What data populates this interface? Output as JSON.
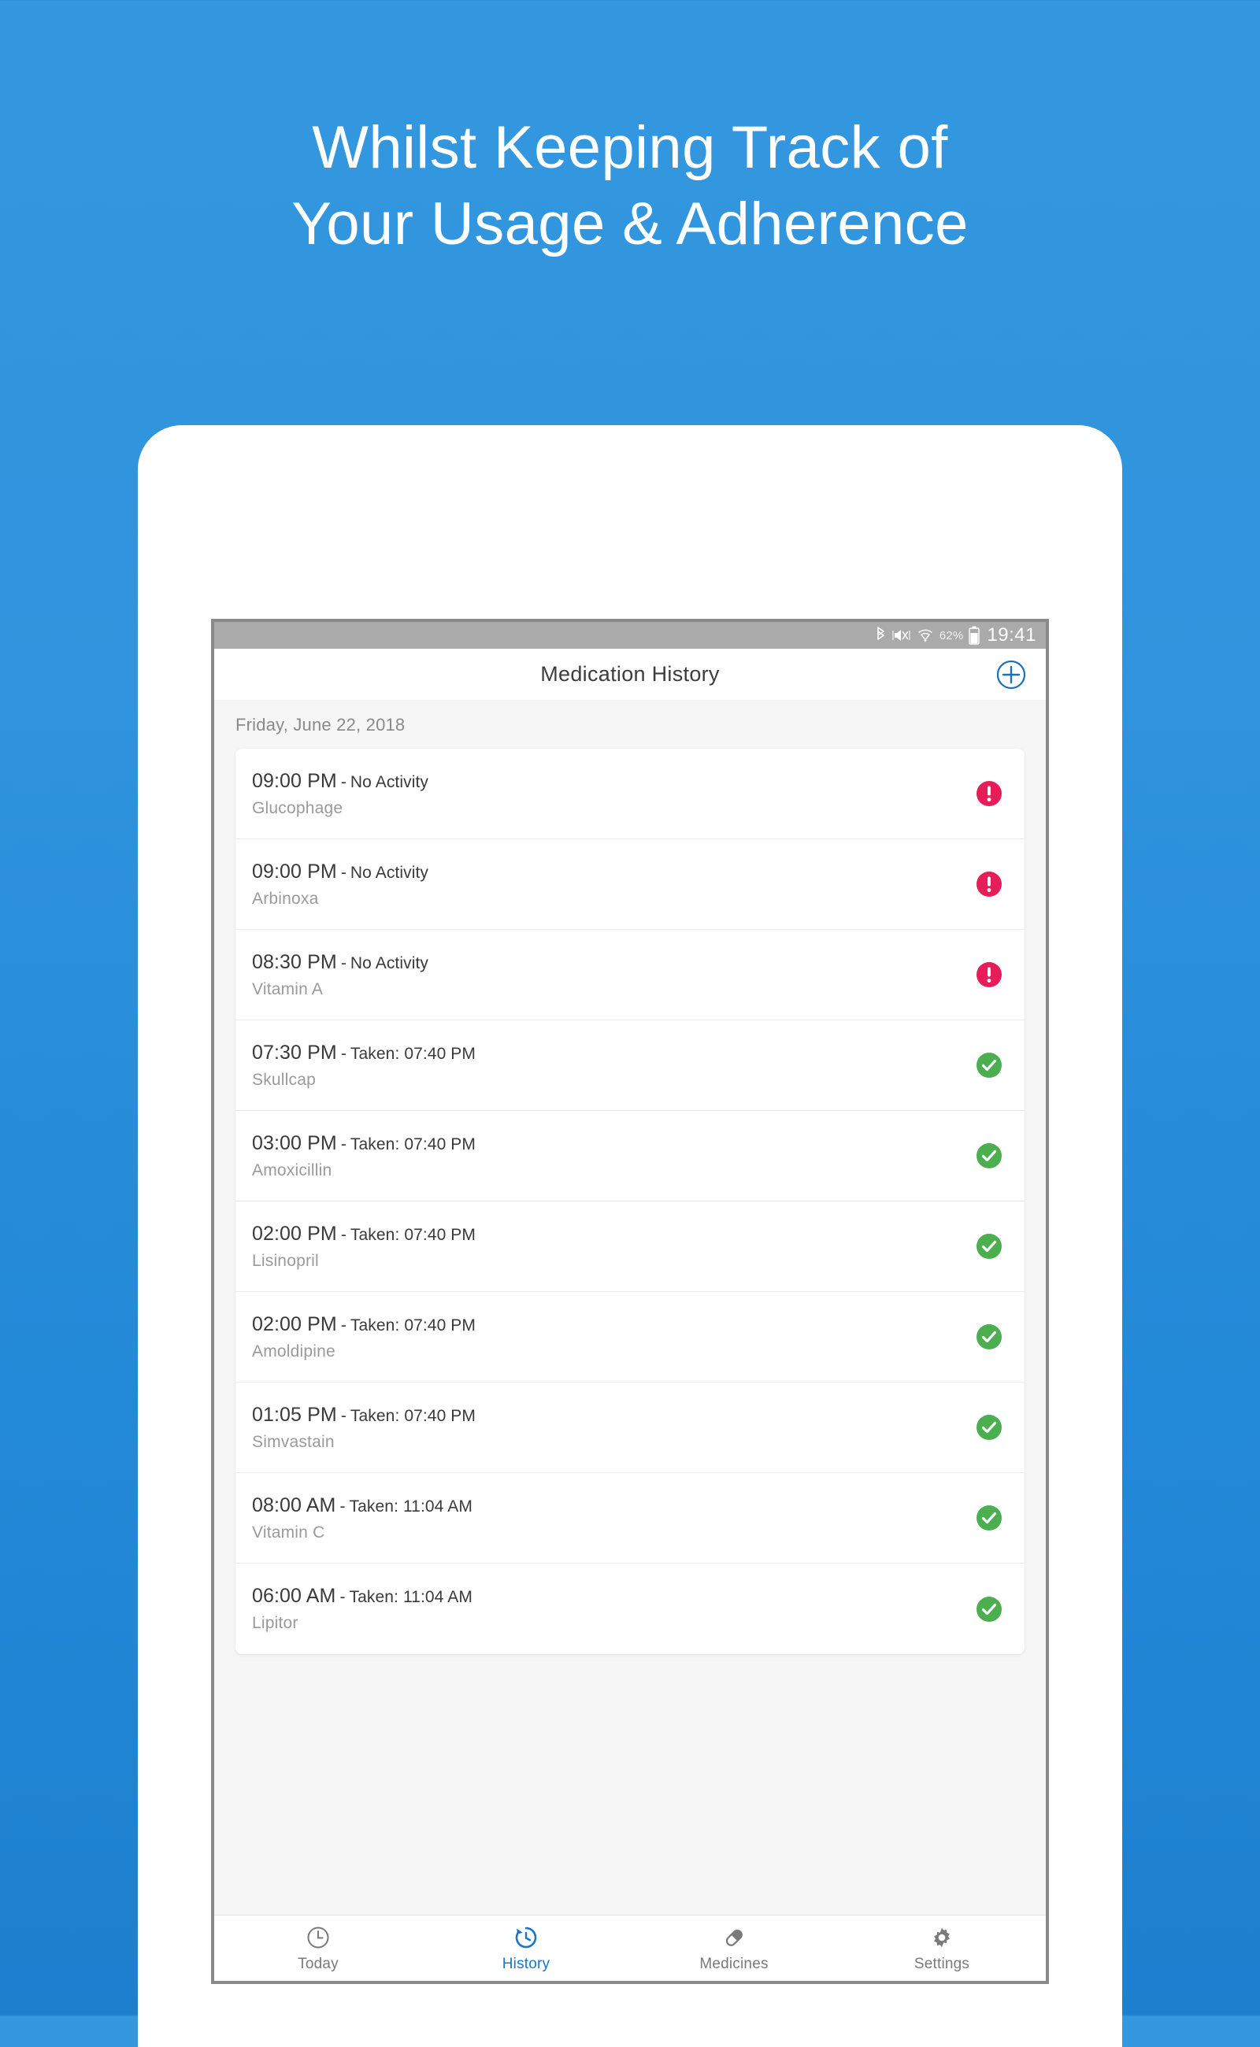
{
  "promo": {
    "headline_line1": "Whilst Keeping Track of",
    "headline_line2": "Your Usage & Adherence",
    "background_top": "#3498e0",
    "background_bottom": "#1d80cf"
  },
  "statusbar": {
    "bluetooth_icon": "bluetooth-icon",
    "mute_icon": "volume-mute-icon",
    "wifi_icon": "wifi-icon",
    "battery_percent": "62%",
    "battery_icon": "battery-icon",
    "clock": "19:41"
  },
  "appbar": {
    "title": "Medication History",
    "add_icon": "plus-circle-icon",
    "accent": "#1976c8"
  },
  "content": {
    "date_header": "Friday, June 22, 2018",
    "rows": [
      {
        "time": "09:00 PM",
        "separator": "-",
        "status": "No Activity",
        "medicine": "Glucophage",
        "badge": "alert",
        "badge_color": "#e71d59"
      },
      {
        "time": "09:00 PM",
        "separator": "-",
        "status": "No Activity",
        "medicine": "Arbinoxa",
        "badge": "alert",
        "badge_color": "#e71d59"
      },
      {
        "time": "08:30 PM",
        "separator": "-",
        "status": "No Activity",
        "medicine": "Vitamin A",
        "badge": "alert",
        "badge_color": "#e71d59"
      },
      {
        "time": "07:30 PM",
        "separator": "-",
        "status": "Taken: 07:40 PM",
        "medicine": "Skullcap",
        "badge": "check",
        "badge_color": "#4caf4f"
      },
      {
        "time": "03:00 PM",
        "separator": "-",
        "status": "Taken: 07:40 PM",
        "medicine": "Amoxicillin",
        "badge": "check",
        "badge_color": "#4caf4f"
      },
      {
        "time": "02:00 PM",
        "separator": "-",
        "status": "Taken: 07:40 PM",
        "medicine": "Lisinopril",
        "badge": "check",
        "badge_color": "#4caf4f"
      },
      {
        "time": "02:00 PM",
        "separator": "-",
        "status": "Taken: 07:40 PM",
        "medicine": "Amoldipine",
        "badge": "check",
        "badge_color": "#4caf4f"
      },
      {
        "time": "01:05 PM",
        "separator": "-",
        "status": "Taken: 07:40 PM",
        "medicine": "Simvastain",
        "badge": "check",
        "badge_color": "#4caf4f"
      },
      {
        "time": "08:00 AM",
        "separator": "-",
        "status": "Taken: 11:04 AM",
        "medicine": "Vitamin C",
        "badge": "check",
        "badge_color": "#4caf4f"
      },
      {
        "time": "06:00 AM",
        "separator": "-",
        "status": "Taken: 11:04 AM",
        "medicine": "Lipitor",
        "badge": "check",
        "badge_color": "#4caf4f"
      }
    ]
  },
  "tabbar": {
    "active_index": 1,
    "tabs": [
      {
        "label": "Today",
        "icon": "clock-icon"
      },
      {
        "label": "History",
        "icon": "history-restore-icon"
      },
      {
        "label": "Medicines",
        "icon": "pill-capsule-icon"
      },
      {
        "label": "Settings",
        "icon": "gear-icon"
      }
    ]
  }
}
